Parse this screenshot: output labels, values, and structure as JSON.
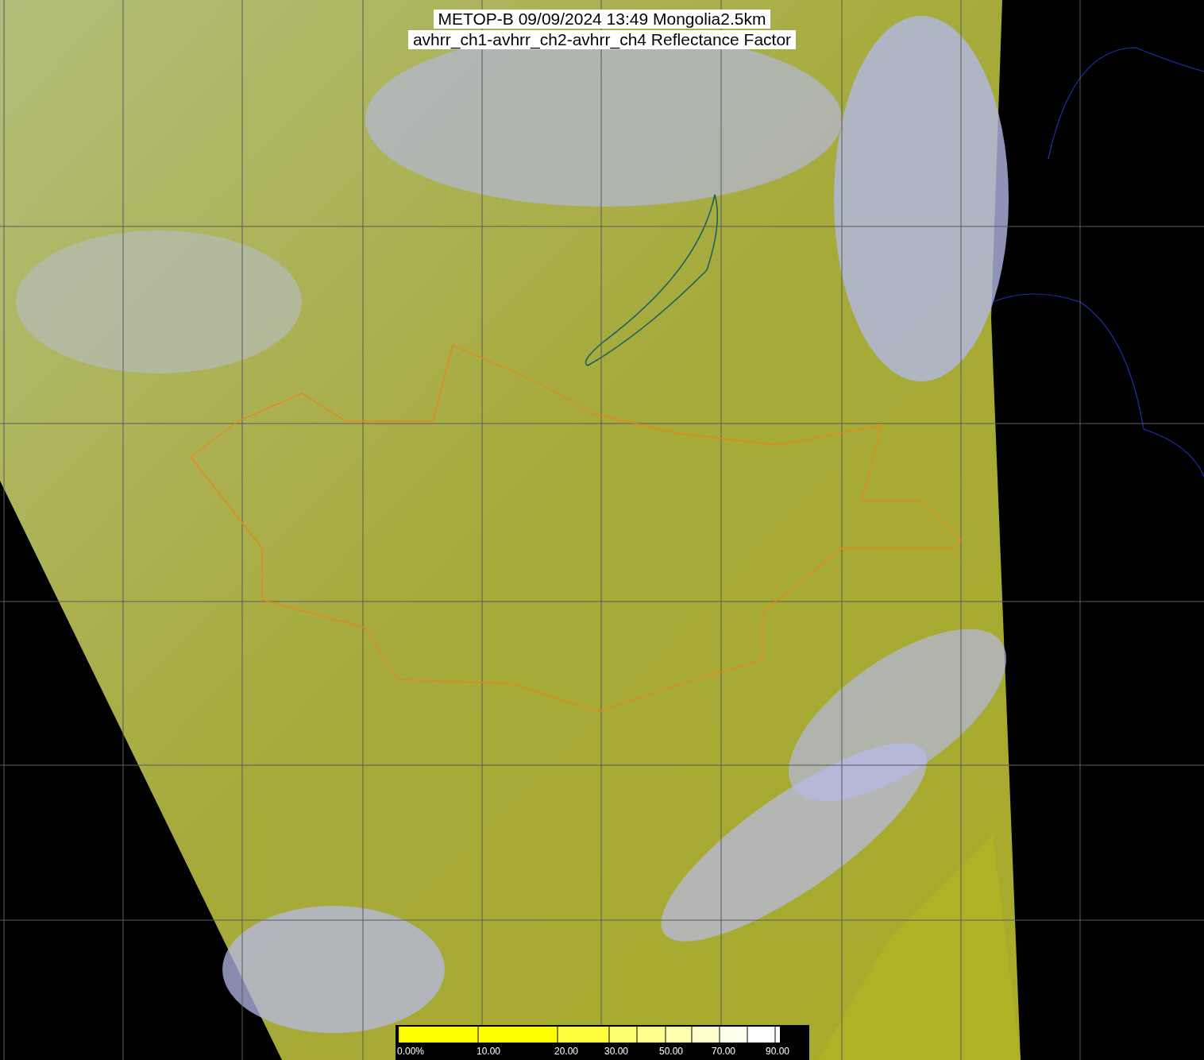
{
  "title": {
    "lines": [
      "METOP-B 09/09/2024 13:49 Mongolia2.5km",
      "avhrr_ch1-avhrr_ch2-avhrr_ch4 Reflectance Factor"
    ]
  },
  "colorbar": {
    "labels": [
      "0.00%",
      "10.00",
      "20.00",
      "30.00",
      "50.00",
      "70.00",
      "90.00"
    ]
  }
}
